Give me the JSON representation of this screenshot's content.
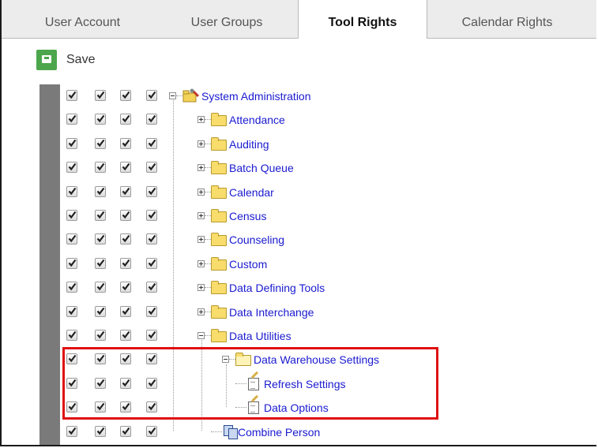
{
  "tabs": [
    {
      "label": "User Account",
      "active": false
    },
    {
      "label": "User Groups",
      "active": false
    },
    {
      "label": "Tool Rights",
      "active": true
    },
    {
      "label": "Calendar Rights",
      "active": false
    }
  ],
  "toolbar": {
    "save_label": "Save"
  },
  "tree": [
    {
      "label": "System Administration",
      "level": 0,
      "icon": "admin-tools-icon",
      "expander": "minus",
      "checks": [
        true,
        true,
        true,
        true
      ]
    },
    {
      "label": "Attendance",
      "level": 1,
      "icon": "folder-icon",
      "expander": "plus",
      "checks": [
        true,
        true,
        true,
        true
      ]
    },
    {
      "label": "Auditing",
      "level": 1,
      "icon": "folder-icon",
      "expander": "plus",
      "checks": [
        true,
        true,
        true,
        true
      ]
    },
    {
      "label": "Batch Queue",
      "level": 1,
      "icon": "folder-icon",
      "expander": "plus",
      "checks": [
        true,
        true,
        true,
        true
      ]
    },
    {
      "label": "Calendar",
      "level": 1,
      "icon": "folder-icon",
      "expander": "plus",
      "checks": [
        true,
        true,
        true,
        true
      ]
    },
    {
      "label": "Census",
      "level": 1,
      "icon": "folder-icon",
      "expander": "plus",
      "checks": [
        true,
        true,
        true,
        true
      ]
    },
    {
      "label": "Counseling",
      "level": 1,
      "icon": "folder-icon",
      "expander": "plus",
      "checks": [
        true,
        true,
        true,
        true
      ]
    },
    {
      "label": "Custom",
      "level": 1,
      "icon": "folder-icon",
      "expander": "plus",
      "checks": [
        true,
        true,
        true,
        true
      ]
    },
    {
      "label": "Data Defining Tools",
      "level": 1,
      "icon": "folder-icon",
      "expander": "plus",
      "checks": [
        true,
        true,
        true,
        true
      ]
    },
    {
      "label": "Data Interchange",
      "level": 1,
      "icon": "folder-icon",
      "expander": "plus",
      "checks": [
        true,
        true,
        true,
        true
      ]
    },
    {
      "label": "Data Utilities",
      "level": 1,
      "icon": "folder-icon",
      "expander": "minus",
      "checks": [
        true,
        true,
        true,
        true
      ]
    },
    {
      "label": "Data Warehouse Settings",
      "level": 2,
      "icon": "open-folder-icon",
      "expander": "minus",
      "checks": [
        true,
        true,
        true,
        true
      ]
    },
    {
      "label": "Refresh Settings",
      "level": 3,
      "icon": "edit-document-icon",
      "expander": "none",
      "checks": [
        true,
        true,
        true,
        true
      ]
    },
    {
      "label": "Data Options",
      "level": 3,
      "icon": "edit-document-icon",
      "expander": "none",
      "checks": [
        true,
        true,
        true,
        true
      ]
    },
    {
      "label": "Combine Person",
      "level": 2,
      "icon": "combine-person-icon",
      "expander": "none",
      "checks": [
        true,
        true,
        true,
        true
      ]
    }
  ],
  "colors": {
    "highlight_border": "#e01010",
    "link_text": "#1a1ad0",
    "save_green": "#4ca64c"
  }
}
